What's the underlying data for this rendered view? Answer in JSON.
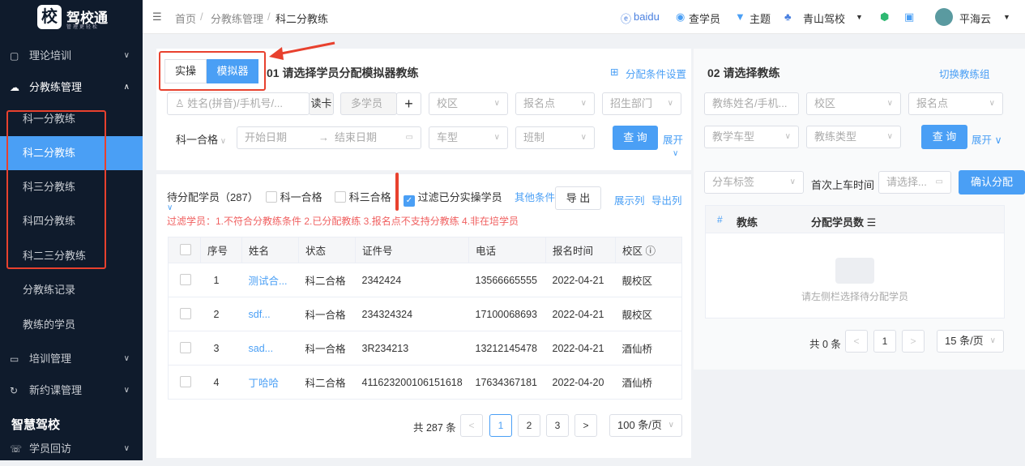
{
  "app": {
    "logo_char": "校",
    "name": "驾校通",
    "slogan": "管理更轻松"
  },
  "sidebar": {
    "items": [
      {
        "label": "理论培训",
        "icon": "book-icon"
      },
      {
        "label": "分教练管理",
        "icon": "cloud-user-icon"
      },
      {
        "label": "科一分教练"
      },
      {
        "label": "科二分教练"
      },
      {
        "label": "科三分教练"
      },
      {
        "label": "科四分教练"
      },
      {
        "label": "科二三分教练"
      },
      {
        "label": "分教练记录"
      },
      {
        "label": "教练的学员"
      },
      {
        "label": "培训管理",
        "icon": "chat-icon"
      },
      {
        "label": "新约课管理",
        "icon": "refresh-icon"
      }
    ],
    "section": "智慧驾校",
    "last": "学员回访"
  },
  "header": {
    "breadcrumb": [
      "首页",
      "分教练管理",
      "科二分教练"
    ],
    "baidu": "baidu",
    "search_student": "查学员",
    "theme": "主题",
    "school": "青山驾校",
    "user": "平海云"
  },
  "left": {
    "modes": [
      "实操",
      "模拟器"
    ],
    "title": "01 请选择学员分配模拟器教练",
    "settings": "分配条件设置",
    "name_placeholder": "姓名(拼音)/手机号/...",
    "read_card": "读卡",
    "multi": "多学员",
    "campus": "校区",
    "signup": "报名点",
    "dept": "招生部门",
    "pass": "科一合格",
    "start": "开始日期",
    "end": "结束日期",
    "car": "车型",
    "class": "班制",
    "query": "查 询",
    "expand": "展开",
    "pending": "待分配学员（287）",
    "cb1": "科一合格",
    "cb2": "科三合格",
    "cb3": "过滤已分实操学员",
    "other": "其他条件",
    "export": "导 出",
    "show_cols": "展示列",
    "export_cols": "导出列",
    "filter_note": "过滤学员：1.不符合分教练条件 2.已分配教练 3.报名点不支持分教练 4.非在培学员",
    "columns": [
      "序号",
      "姓名",
      "状态",
      "证件号",
      "电话",
      "报名时间",
      "校区"
    ],
    "rows": [
      [
        "1",
        "测试合...",
        "科二合格",
        "2342424",
        "13566665555",
        "2022-04-21",
        "靓校区"
      ],
      [
        "2",
        "sdf...",
        "科一合格",
        "234324324",
        "17100068693",
        "2022-04-21",
        "靓校区"
      ],
      [
        "3",
        "sad...",
        "科一合格",
        "3R234213",
        "13212145478",
        "2022-04-21",
        "酒仙桥"
      ],
      [
        "4",
        "丁哈哈",
        "科二合格",
        "411623200106151618",
        "17634367181",
        "2022-04-20",
        "酒仙桥"
      ]
    ],
    "total": "共 287 条",
    "pages": [
      "1",
      "2",
      "3"
    ],
    "page_size": "100 条/页"
  },
  "right": {
    "title": "02 请选择教练",
    "switch": "切换教练组",
    "coach_placeholder": "教练姓名/手机...",
    "campus": "校区",
    "signup": "报名点",
    "car": "教学车型",
    "type": "教练类型",
    "query": "查 询",
    "expand": "展开",
    "tag": "分车标签",
    "first_time": "首次上车时间",
    "date_placeholder": "请选择...",
    "confirm": "确认分配",
    "columns": [
      "#",
      "教练",
      "分配学员数"
    ],
    "empty": "请左侧栏选择待分配学员",
    "total": "共 0 条",
    "page": "1",
    "page_size": "15 条/页"
  }
}
